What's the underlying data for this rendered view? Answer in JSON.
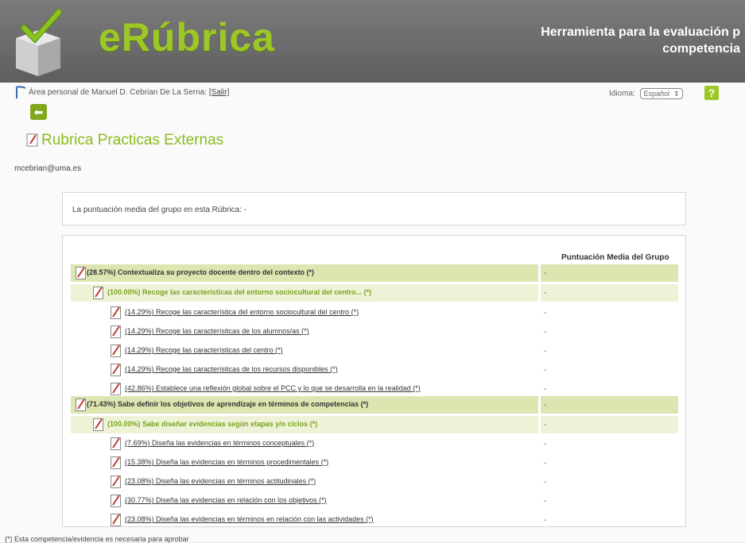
{
  "colors": {
    "accent": "#9cc726",
    "header_bg": "#6e6e6e",
    "row_level1": "#dbe6b0",
    "row_level2": "#eef3d8"
  },
  "header": {
    "brand": "eRúbrica",
    "tagline_line1": "Herramienta para la evaluación p",
    "tagline_line2": "competencia"
  },
  "userbar": {
    "prefix": "Área personal de Manuel D. Cebrian De La Serna:",
    "logout": "[Salir]",
    "language_label": "Idioma:",
    "language_value": "Español",
    "help": "?"
  },
  "page": {
    "title": "Rubrica Practicas Externas",
    "email": "mcebrian@uma.es",
    "group_average": "La puntuación media del grupo en esta Rúbrica: -",
    "column_header": "Puntuación Media del Grupo",
    "footnote": "(*) Esta competencia/evidencia es necesaria para aprobar"
  },
  "rows": [
    {
      "level": 1,
      "label": "(28.57%) Contextualiza su proyecto docente dentro del contexto (*)",
      "score": "-"
    },
    {
      "level": 2,
      "label": "(100.00%) Recoge las características del entorno sociocultural del centro... (*)",
      "score": "-"
    },
    {
      "level": 3,
      "label": "(14.29%) Recoge las característica del entorno sociocultural del centro (*)",
      "score": "-"
    },
    {
      "level": 3,
      "label": "(14.29%) Recoge las características de los alumnos/as (*)",
      "score": "-"
    },
    {
      "level": 3,
      "label": "(14.29%) Recoge las características del centro (*)",
      "score": "-"
    },
    {
      "level": 3,
      "label": "(14.29%) Recoge las características de los recursos disponibles (*)",
      "score": "-"
    },
    {
      "level": 3,
      "label": "(42.86%) Establece una reflexión global sobre el PCC y lo que se desarrolla en la realidad (*)",
      "score": "-"
    },
    {
      "level": 1,
      "label": "(71.43%) Sabe definir los objetivos de aprendizaje en términos de competencias (*)",
      "score": "-"
    },
    {
      "level": 2,
      "label": "(100.00%) Sabe diseñar evidencias según etapas y/o ciclos (*)",
      "score": "-"
    },
    {
      "level": 3,
      "label": "(7.69%) Diseña las evidencias en términos conceptuales (*)",
      "score": "-"
    },
    {
      "level": 3,
      "label": "(15.38%) Diseña las evidencias en términos procedimentales (*)",
      "score": "-"
    },
    {
      "level": 3,
      "label": "(23.08%) Diseña las evidencias en términos actitudinales (*)",
      "score": "-"
    },
    {
      "level": 3,
      "label": "(30.77%) Diseña las evidencias en relación con los objetivos (*)",
      "score": "-"
    },
    {
      "level": 3,
      "label": "(23.08%) Diseña las evidencias en términos en relación con las actividades (*)",
      "score": "-"
    }
  ]
}
